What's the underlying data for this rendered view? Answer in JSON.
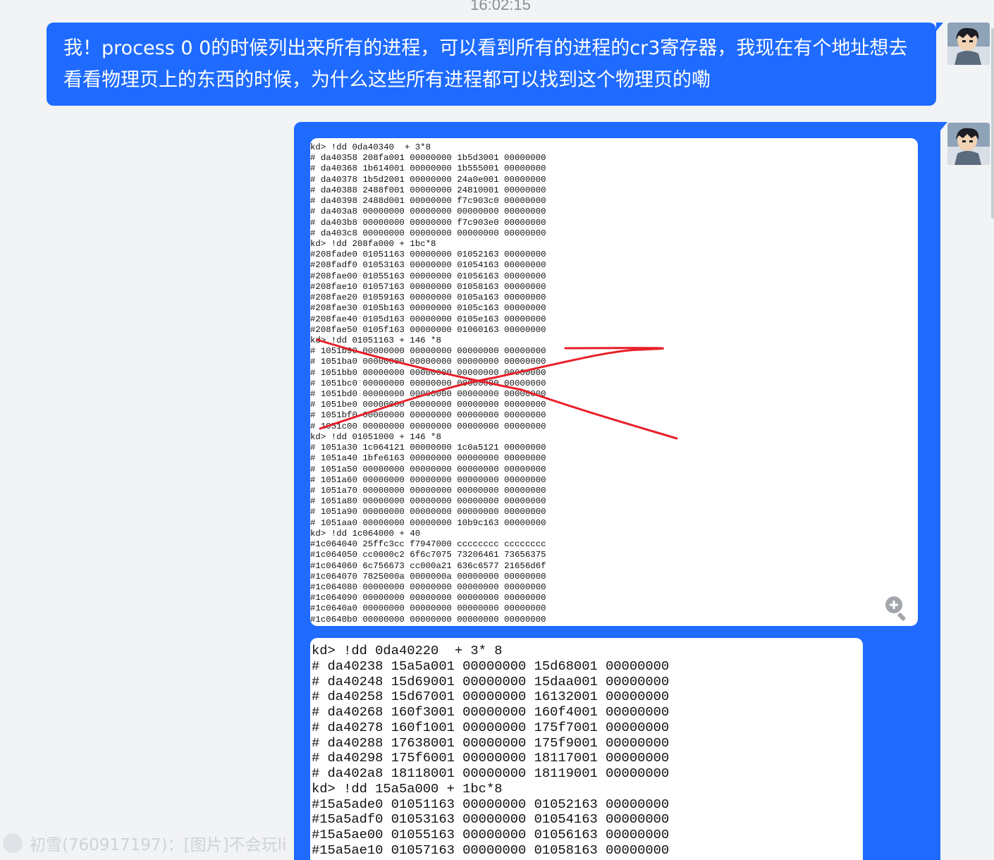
{
  "chat": {
    "timestamp": "16:02:15",
    "message_text": "我！process 0 0的时候列出来所有的进程，可以看到所有的进程的cr3寄存器，我现在有个地址想去看看物理页上的东西的时候，为什么这些所有进程都可以找到这个物理页的嘞",
    "reply_preview": "初雪(760917197)：[图片]不会玩li"
  },
  "colors": {
    "bubble": "#1f6bff",
    "background": "#f2f3f5",
    "annotation_cross": "#e8202a"
  },
  "icons": {
    "zoom": "magnifier-plus-icon",
    "avatar": "user-avatar"
  },
  "screenshot_1": {
    "lines": [
      "kd> !dd 0da40340  + 3*8",
      "# da40358 208fa001 00000000 1b5d3001 00000000",
      "# da40368 1b614001 00000000 1b555001 00000000",
      "# da40378 1b5d2001 00000000 24a0e001 00000000",
      "# da40388 2488f001 00000000 24810001 00000000",
      "# da40398 2488d001 00000000 f7c903c0 00000000",
      "# da403a8 00000000 00000000 00000000 00000000",
      "# da403b8 00000000 00000000 f7c903e0 00000000",
      "# da403c8 00000000 00000000 00000000 00000000",
      "kd> !dd 208fa000 + 1bc*8",
      "#208fade0 01051163 00000000 01052163 00000000",
      "#208fadf0 01053163 00000000 01054163 00000000",
      "#208fae00 01055163 00000000 01056163 00000000",
      "#208fae10 01057163 00000000 01058163 00000000",
      "#208fae20 01059163 00000000 0105a163 00000000",
      "#208fae30 0105b163 00000000 0105c163 00000000",
      "#208fae40 0105d163 00000000 0105e163 00000000",
      "#208fae50 0105f163 00000000 01060163 00000000",
      "kd> !dd 01051163 + 146 *8",
      "# 1051b90 00000000 00000000 00000000 00000000",
      "# 1051ba0 00000000 00000000 00000000 00000000",
      "# 1051bb0 00000000 00000000 00000000 00000000",
      "# 1051bc0 00000000 00000000 00000000 00000000",
      "# 1051bd0 00000000 00000000 00000000 00000000",
      "# 1051be0 00000000 00000000 00000000 00000000",
      "# 1051bf0 00000000 00000000 00000000 00000000",
      "# 1051c00 00000000 00000000 00000000 00000000",
      "kd> !dd 01051000 + 146 *8",
      "# 1051a30 1c064121 00000000 1c0a5121 00000000",
      "# 1051a40 1bfe6163 00000000 00000000 00000000",
      "# 1051a50 00000000 00000000 00000000 00000000",
      "# 1051a60 00000000 00000000 00000000 00000000",
      "# 1051a70 00000000 00000000 00000000 00000000",
      "# 1051a80 00000000 00000000 00000000 00000000",
      "# 1051a90 00000000 00000000 00000000 00000000",
      "# 1051aa0 00000000 00000000 10b9c163 00000000",
      "kd> !dd 1c064000 + 40",
      "#1c064040 25ffc3cc f7947000 cccccccc cccccccc",
      "#1c064050 cc0000c2 6f6c7075 73206461 73656375",
      "#1c064060 6c756673 cc000a21 636c6577 21656d6f",
      "#1c064070 7825000a 0000000a 00000000 00000000",
      "#1c064080 00000000 00000000 00000000 00000000",
      "#1c064090 00000000 00000000 00000000 00000000",
      "#1c0640a0 00000000 00000000 00000000 00000000",
      "#1c0640b0 00000000 00000000 00000000 00000000"
    ]
  },
  "screenshot_2": {
    "lines": [
      "kd> !dd 0da40220  + 3* 8",
      "# da40238 15a5a001 00000000 15d68001 00000000",
      "# da40248 15d69001 00000000 15daa001 00000000",
      "# da40258 15d67001 00000000 16132001 00000000",
      "# da40268 160f3001 00000000 160f4001 00000000",
      "# da40278 160f1001 00000000 175f7001 00000000",
      "# da40288 17638001 00000000 175f9001 00000000",
      "# da40298 175f6001 00000000 18117001 00000000",
      "# da402a8 18118001 00000000 18119001 00000000",
      "kd> !dd 15a5a000 + 1bc*8",
      "#15a5ade0 01051163 00000000 01052163 00000000",
      "#15a5adf0 01053163 00000000 01054163 00000000",
      "#15a5ae00 01055163 00000000 01056163 00000000",
      "#15a5ae10 01057163 00000000 01058163 00000000"
    ]
  }
}
